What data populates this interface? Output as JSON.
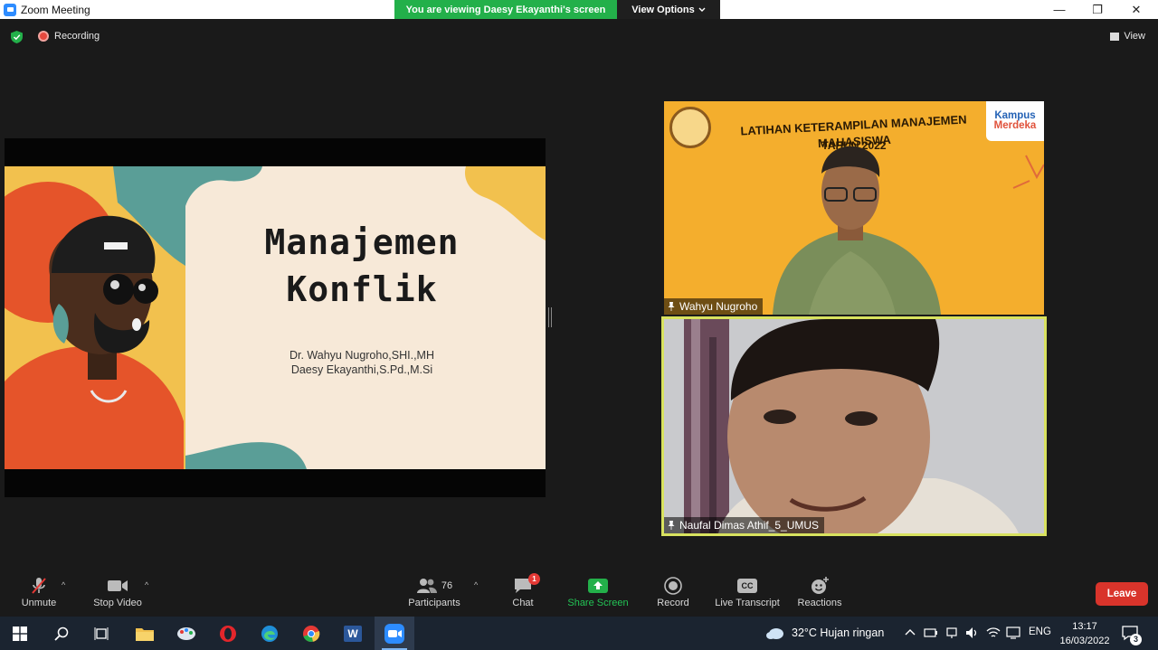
{
  "window": {
    "title": "Zoom Meeting",
    "viewing_banner": "You are viewing Daesy Ekayanthi's screen",
    "view_options_label": "View Options",
    "minimize": "—",
    "restore": "❐",
    "close": "✕"
  },
  "status": {
    "recording_label": "Recording",
    "view_label": "View"
  },
  "shared_slide": {
    "title_line1": "Manajemen",
    "title_line2": "Konflik",
    "author1": "Dr. Wahyu Nugroho,SHI.,MH",
    "author2": "Daesy Ekayanthi,S.Pd.,M.Si"
  },
  "participants_tiles": [
    {
      "name": "Wahyu Nugroho",
      "event_title": "LATIHAN KETERAMPILAN MANAJEMEN MAHASISWA",
      "event_year": "TAHUN 2022",
      "logo_line1": "Kampus",
      "logo_line2": "Merdeka"
    },
    {
      "name": "Naufal Dimas Athif_5_UMUS"
    }
  ],
  "toolbar": {
    "unmute": "Unmute",
    "stop_video": "Stop Video",
    "participants": "Participants",
    "participants_count": "76",
    "chat": "Chat",
    "chat_badge": "1",
    "share_screen": "Share Screen",
    "record": "Record",
    "live_transcript": "Live Transcript",
    "reactions": "Reactions",
    "leave": "Leave",
    "cc": "CC",
    "caret": "^"
  },
  "taskbar": {
    "weather": "32°C  Hujan ringan",
    "language": "ENG",
    "time": "13:17",
    "date": "16/03/2022",
    "notification_count": "3",
    "word_letter": "W"
  },
  "colors": {
    "share_green": "#23b04a",
    "leave_red": "#d9342b",
    "active_speaker": "#d8e25f",
    "zoom_blue": "#2d8cff"
  }
}
